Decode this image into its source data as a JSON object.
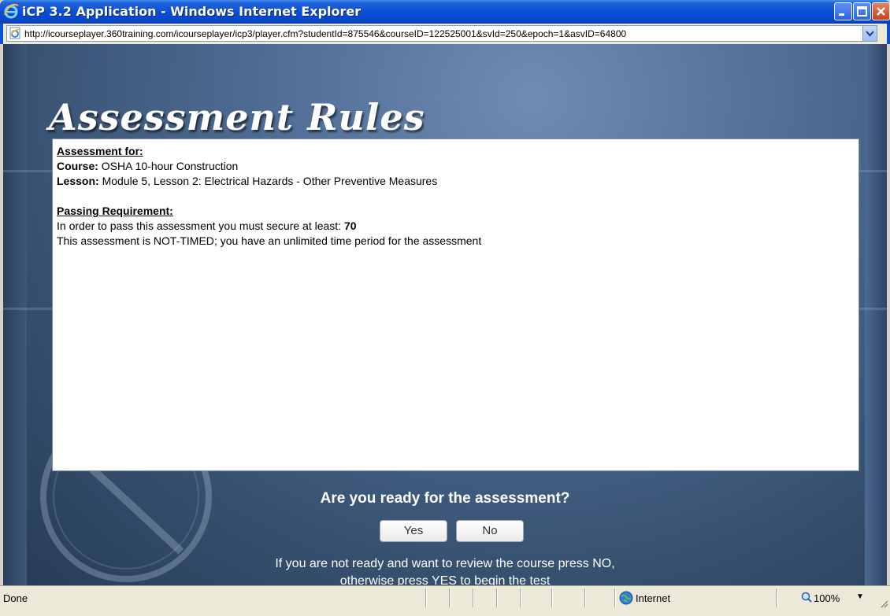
{
  "window": {
    "title": "iCP 3.2 Application - Windows Internet Explorer",
    "icon": "ie-icon",
    "controls": [
      "minimize-icon",
      "maximize-icon",
      "close-icon"
    ]
  },
  "address_bar": {
    "url": "http://icourseplayer.360training.com/icourseplayer/icp3/player.cfm?studentId=875546&courseID=122525001&svId=250&epoch=1&asvID=64800"
  },
  "page": {
    "heading": "Assessment Rules",
    "rules": {
      "assessment_for_label": "Assessment for:",
      "course_label": "Course:",
      "course_value": "OSHA 10-hour Construction",
      "lesson_label": "Lesson:",
      "lesson_value": "Module 5, Lesson 2: Electrical Hazards - Other Preventive Measures",
      "passing_label": "Passing Requirement:",
      "passing_text": "In order to pass this assessment you must secure at least:",
      "passing_score": "70",
      "timing_text": "This assessment is NOT-TIMED; you have an unlimited time period for the assessment"
    },
    "question": "Are you ready for the assessment?",
    "yes_label": "Yes",
    "no_label": "No",
    "hint_line1": "If you are not ready and want to review the course press NO,",
    "hint_line2": "otherwise press YES to begin the test"
  },
  "status_bar": {
    "status": "Done",
    "zone": "Internet",
    "zoom": "100%"
  },
  "colors": {
    "title_bar": "#0a4fd6",
    "content_bg": "#4f6d95",
    "close_button": "#c9421e"
  }
}
